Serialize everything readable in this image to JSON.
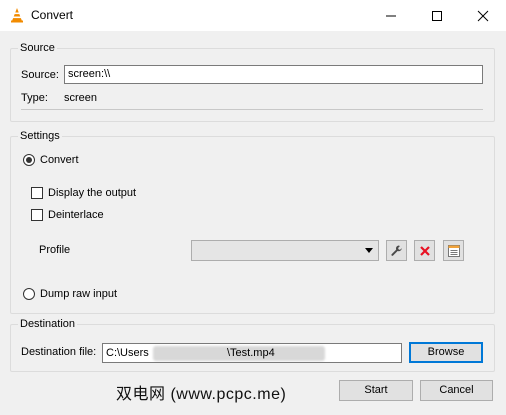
{
  "window": {
    "title": "Convert"
  },
  "source": {
    "group_title": "Source",
    "source_label": "Source:",
    "source_value": "screen:\\\\",
    "type_label": "Type:",
    "type_value": "screen"
  },
  "settings": {
    "group_title": "Settings",
    "convert_label": "Convert",
    "display_output_label": "Display the output",
    "deinterlace_label": "Deinterlace",
    "profile_label": "Profile",
    "profile_value": "",
    "dump_raw_label": "Dump raw input",
    "convert_selected": true,
    "display_output_checked": false,
    "deinterlace_checked": false,
    "dump_raw_selected": false
  },
  "destination": {
    "group_title": "Destination",
    "file_label": "Destination file:",
    "file_prefix": "C:\\Users",
    "file_suffix": "\\Test.mp4",
    "browse_label": "Browse"
  },
  "footer": {
    "watermark": "双电网 (www.pcpc.me)",
    "start_label": "Start",
    "cancel_label": "Cancel"
  },
  "icons": {
    "app": "vlc-cone-icon",
    "edit_profile": "wrench-icon",
    "delete_profile": "red-x-icon",
    "new_profile": "list-icon"
  },
  "colors": {
    "accent": "#0078d7",
    "delete": "#e81123",
    "vlc_orange": "#f28b00"
  }
}
